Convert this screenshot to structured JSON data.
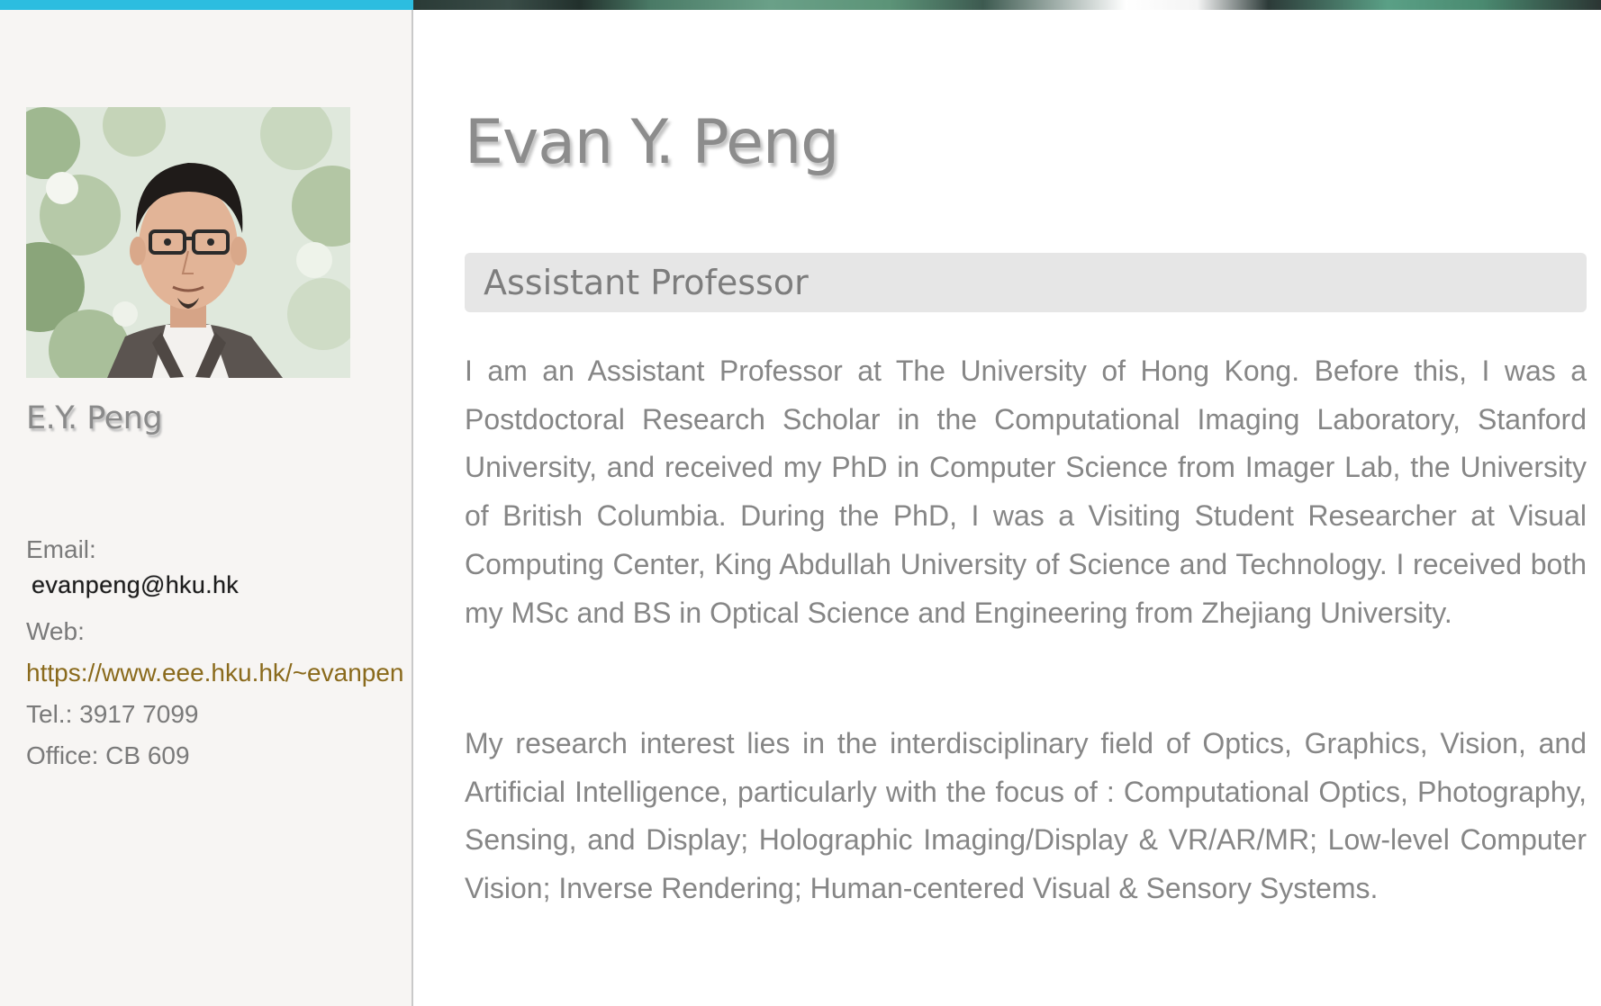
{
  "header": {
    "name": "Evan Y. Peng",
    "role": "Assistant Professor"
  },
  "sidebar": {
    "short_name": "E.Y. Peng",
    "email_label": "Email:",
    "email_value": "evanpeng@hku.hk",
    "web_label": "Web:",
    "web_url": "https://www.eee.hku.hk/~evanpen",
    "tel": "Tel.: 3917 7099",
    "office": "Office: CB 609"
  },
  "bio": {
    "paragraph_1": "I am an Assistant Professor at The University of Hong Kong. Before this, I was a Postdoctoral Research Scholar in the Computational Imaging Laboratory, Stanford University, and received my PhD in Computer Science from Imager Lab, the University of British Columbia. During the PhD, I was a Visiting Student Researcher at Visual Computing Center, King Abdullah University of Science and Technology. I received both my MSc and BS in Optical Science and Engineering from Zhejiang University.",
    "paragraph_2": "My research interest lies in the interdisciplinary field of Optics, Graphics, Vision, and Artificial Intelligence, particularly with the focus of : Computational Optics, Photography, Sensing, and Display; Holographic Imaging/Display & VR/AR/MR; Low-level Computer Vision; Inverse Rendering; Human-centered Visual & Sensory Systems."
  },
  "colors": {
    "accent_bar": "#2cbde0",
    "link": "#8a6a1c",
    "sidebar_bg": "#f7f5f3",
    "role_bar_bg": "#e6e6e6",
    "text": "#868686"
  },
  "icons": {
    "avatar": "profile-photo"
  }
}
